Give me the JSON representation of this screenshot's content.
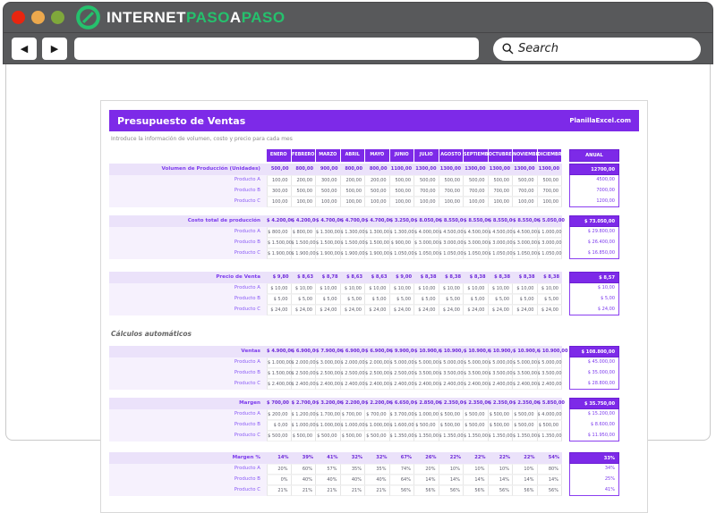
{
  "chrome": {
    "logo_internet": "INTERNET",
    "logo_paso1": "PASO",
    "logo_a": "A",
    "logo_paso2": "PASO",
    "back_glyph": "◀",
    "forward_glyph": "▶",
    "url_value": "",
    "search_placeholder": "Search",
    "colors": {
      "bar": "#58595b",
      "close": "#e8250f",
      "minimize": "#eca84d",
      "maximize": "#7fa83b",
      "logo_green": "#25c16d"
    }
  },
  "sheet": {
    "title": "Presupuesto de Ventas",
    "brand": "PlanillaExcel.com",
    "subtitle": "Introduce la información de volumen, costo y precio para cada mes",
    "anual_label": "ANUAL",
    "accent_color": "#7d2ae8",
    "months": [
      "ENERO",
      "FEBRERO",
      "MARZO",
      "ABRIL",
      "MAYO",
      "JUNIO",
      "JULIO",
      "AGOSTO",
      "SEPTIEMBRE",
      "OCTUBRE",
      "NOVIEMBRE",
      "DICIEMBRE"
    ],
    "blocks": [
      {
        "id": "volumen",
        "label": "Volumen de Producción (Unidades)",
        "total": [
          "500,00",
          "800,00",
          "900,00",
          "800,00",
          "800,00",
          "1100,00",
          "1300,00",
          "1300,00",
          "1300,00",
          "1300,00",
          "1300,00",
          "1300,00"
        ],
        "total_anual": "12700,00",
        "rows": [
          {
            "label": "Producto A",
            "values": [
              "100,00",
              "200,00",
              "300,00",
              "200,00",
              "200,00",
              "500,00",
              "500,00",
              "500,00",
              "500,00",
              "500,00",
              "500,00",
              "500,00"
            ],
            "anual": "4500,00"
          },
          {
            "label": "Producto B",
            "values": [
              "300,00",
              "500,00",
              "500,00",
              "500,00",
              "500,00",
              "500,00",
              "700,00",
              "700,00",
              "700,00",
              "700,00",
              "700,00",
              "700,00"
            ],
            "anual": "7000,00"
          },
          {
            "label": "Producto C",
            "values": [
              "100,00",
              "100,00",
              "100,00",
              "100,00",
              "100,00",
              "100,00",
              "100,00",
              "100,00",
              "100,00",
              "100,00",
              "100,00",
              "100,00"
            ],
            "anual": "1200,00"
          }
        ]
      },
      {
        "id": "costo",
        "label": "Costo total de producción",
        "total": [
          "$ 4.200,00",
          "$ 4.200,00",
          "$ 4.700,00",
          "$ 4.700,00",
          "$ 4.700,00",
          "$ 3.250,00",
          "$ 8.050,00",
          "$ 8.550,00",
          "$ 8.550,00",
          "$ 8.550,00",
          "$ 8.550,00",
          "$ 5.050,00"
        ],
        "total_anual": "$ 73.050,00",
        "rows": [
          {
            "label": "Producto A",
            "values": [
              "$ 800,00",
              "$ 800,00",
              "$ 1.300,00",
              "$ 1.300,00",
              "$ 1.300,00",
              "$ 1.300,00",
              "$ 4.000,00",
              "$ 4.500,00",
              "$ 4.500,00",
              "$ 4.500,00",
              "$ 4.500,00",
              "$ 1.000,00"
            ],
            "anual": "$ 29.800,00"
          },
          {
            "label": "Producto B",
            "values": [
              "$ 1.500,00",
              "$ 1.500,00",
              "$ 1.500,00",
              "$ 1.500,00",
              "$ 1.500,00",
              "$ 900,00",
              "$ 3.000,00",
              "$ 3.000,00",
              "$ 3.000,00",
              "$ 3.000,00",
              "$ 3.000,00",
              "$ 3.000,00"
            ],
            "anual": "$ 26.400,00"
          },
          {
            "label": "Producto C",
            "values": [
              "$ 1.900,00",
              "$ 1.900,00",
              "$ 1.900,00",
              "$ 1.900,00",
              "$ 1.900,00",
              "$ 1.050,00",
              "$ 1.050,00",
              "$ 1.050,00",
              "$ 1.050,00",
              "$ 1.050,00",
              "$ 1.050,00",
              "$ 1.050,00"
            ],
            "anual": "$ 16.850,00"
          }
        ]
      },
      {
        "id": "precio",
        "label": "Precio de Venta",
        "total": [
          "$ 9,80",
          "$ 8,63",
          "$ 8,78",
          "$ 8,63",
          "$ 8,63",
          "$ 9,00",
          "$ 8,38",
          "$ 8,38",
          "$ 8,38",
          "$ 8,38",
          "$ 8,38",
          "$ 8,38"
        ],
        "total_anual": "$ 8,57",
        "rows": [
          {
            "label": "Producto A",
            "values": [
              "$ 10,00",
              "$ 10,00",
              "$ 10,00",
              "$ 10,00",
              "$ 10,00",
              "$ 10,00",
              "$ 10,00",
              "$ 10,00",
              "$ 10,00",
              "$ 10,00",
              "$ 10,00",
              "$ 10,00"
            ],
            "anual": "$ 10,00"
          },
          {
            "label": "Producto B",
            "values": [
              "$ 5,00",
              "$ 5,00",
              "$ 5,00",
              "$ 5,00",
              "$ 5,00",
              "$ 5,00",
              "$ 5,00",
              "$ 5,00",
              "$ 5,00",
              "$ 5,00",
              "$ 5,00",
              "$ 5,00"
            ],
            "anual": "$ 5,00"
          },
          {
            "label": "Producto C",
            "values": [
              "$ 24,00",
              "$ 24,00",
              "$ 24,00",
              "$ 24,00",
              "$ 24,00",
              "$ 24,00",
              "$ 24,00",
              "$ 24,00",
              "$ 24,00",
              "$ 24,00",
              "$ 24,00",
              "$ 24,00"
            ],
            "anual": "$ 24,00"
          }
        ]
      },
      {
        "id": "ventas",
        "section_header": "Cálculos automáticos",
        "label": "Ventas",
        "total": [
          "$ 4.900,00",
          "$ 6.900,00",
          "$ 7.900,00",
          "$ 6.900,00",
          "$ 6.900,00",
          "$ 9.900,00",
          "$ 10.900,00",
          "$ 10.900,00",
          "$ 10.900,00",
          "$ 10.900,00",
          "$ 10.900,00",
          "$ 10.900,00"
        ],
        "total_anual": "$ 108.800,00",
        "rows": [
          {
            "label": "Producto A",
            "values": [
              "$ 1.000,00",
              "$ 2.000,00",
              "$ 3.000,00",
              "$ 2.000,00",
              "$ 2.000,00",
              "$ 5.000,00",
              "$ 5.000,00",
              "$ 5.000,00",
              "$ 5.000,00",
              "$ 5.000,00",
              "$ 5.000,00",
              "$ 5.000,00"
            ],
            "anual": "$ 45.000,00"
          },
          {
            "label": "Producto B",
            "values": [
              "$ 1.500,00",
              "$ 2.500,00",
              "$ 2.500,00",
              "$ 2.500,00",
              "$ 2.500,00",
              "$ 2.500,00",
              "$ 3.500,00",
              "$ 3.500,00",
              "$ 3.500,00",
              "$ 3.500,00",
              "$ 3.500,00",
              "$ 3.500,00"
            ],
            "anual": "$ 35.000,00"
          },
          {
            "label": "Producto C",
            "values": [
              "$ 2.400,00",
              "$ 2.400,00",
              "$ 2.400,00",
              "$ 2.400,00",
              "$ 2.400,00",
              "$ 2.400,00",
              "$ 2.400,00",
              "$ 2.400,00",
              "$ 2.400,00",
              "$ 2.400,00",
              "$ 2.400,00",
              "$ 2.400,00"
            ],
            "anual": "$ 28.800,00"
          }
        ]
      },
      {
        "id": "margen",
        "label": "Margen",
        "total": [
          "$ 700,00",
          "$ 2.700,00",
          "$ 3.200,00",
          "$ 2.200,00",
          "$ 2.200,00",
          "$ 6.650,00",
          "$ 2.850,00",
          "$ 2.350,00",
          "$ 2.350,00",
          "$ 2.350,00",
          "$ 2.350,00",
          "$ 5.850,00"
        ],
        "total_anual": "$ 35.750,00",
        "rows": [
          {
            "label": "Producto A",
            "values": [
              "$ 200,00",
              "$ 1.200,00",
              "$ 1.700,00",
              "$ 700,00",
              "$ 700,00",
              "$ 3.700,00",
              "$ 1.000,00",
              "$ 500,00",
              "$ 500,00",
              "$ 500,00",
              "$ 500,00",
              "$ 4.000,00"
            ],
            "anual": "$ 15.200,00"
          },
          {
            "label": "Producto B",
            "values": [
              "$ 0,00",
              "$ 1.000,00",
              "$ 1.000,00",
              "$ 1.000,00",
              "$ 1.000,00",
              "$ 1.600,00",
              "$ 500,00",
              "$ 500,00",
              "$ 500,00",
              "$ 500,00",
              "$ 500,00",
              "$ 500,00"
            ],
            "anual": "$ 8.600,00"
          },
          {
            "label": "Producto C",
            "values": [
              "$ 500,00",
              "$ 500,00",
              "$ 500,00",
              "$ 500,00",
              "$ 500,00",
              "$ 1.350,00",
              "$ 1.350,00",
              "$ 1.350,00",
              "$ 1.350,00",
              "$ 1.350,00",
              "$ 1.350,00",
              "$ 1.350,00"
            ],
            "anual": "$ 11.950,00"
          }
        ]
      },
      {
        "id": "margen-pct",
        "label": "Margen %",
        "total": [
          "14%",
          "39%",
          "41%",
          "32%",
          "32%",
          "67%",
          "26%",
          "22%",
          "22%",
          "22%",
          "22%",
          "54%"
        ],
        "total_anual": "33%",
        "rows": [
          {
            "label": "Producto A",
            "values": [
              "20%",
              "60%",
              "57%",
              "35%",
              "35%",
              "74%",
              "20%",
              "10%",
              "10%",
              "10%",
              "10%",
              "80%"
            ],
            "anual": "34%"
          },
          {
            "label": "Producto B",
            "values": [
              "0%",
              "40%",
              "40%",
              "40%",
              "40%",
              "64%",
              "14%",
              "14%",
              "14%",
              "14%",
              "14%",
              "14%"
            ],
            "anual": "25%"
          },
          {
            "label": "Producto C",
            "values": [
              "21%",
              "21%",
              "21%",
              "21%",
              "21%",
              "56%",
              "56%",
              "56%",
              "56%",
              "56%",
              "56%",
              "56%"
            ],
            "anual": "41%"
          }
        ]
      }
    ]
  }
}
